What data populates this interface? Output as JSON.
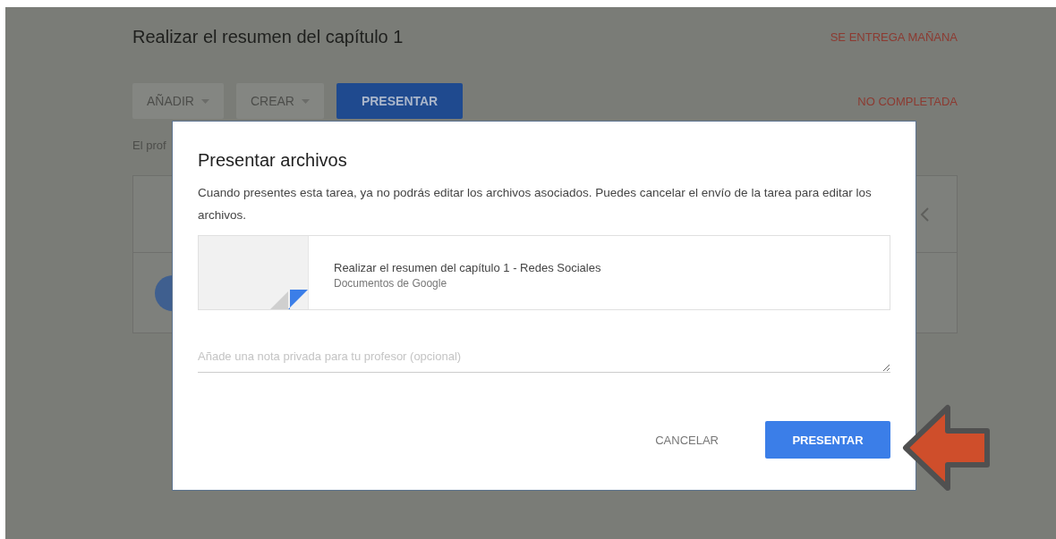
{
  "page": {
    "title": "Realizar el resumen del capítulo 1",
    "due": "SE ENTREGA MAÑANA",
    "status": "NO COMPLETADA",
    "actions": [
      {
        "label": "AÑADIR",
        "kind": "dropdown"
      },
      {
        "label": "CREAR",
        "kind": "dropdown"
      },
      {
        "label": "PRESENTAR",
        "kind": "primary"
      }
    ],
    "note": "El prof"
  },
  "dialog": {
    "title": "Presentar archivos",
    "message": "Cuando presentes esta tarea, ya no podrás editar los archivos asociados. Puedes cancelar el envío de la tarea para editar los archivos.",
    "attachment": {
      "name": "Realizar el resumen del capítulo 1 - Redes Sociales",
      "type": "Documentos de Google"
    },
    "note_field": {
      "placeholder": "Añade una nota privada para tu profesor (opcional)"
    },
    "buttons": [
      {
        "label": "CANCELAR",
        "kind": "flat"
      },
      {
        "label": "PRESENTAR",
        "kind": "primary"
      }
    ]
  }
}
